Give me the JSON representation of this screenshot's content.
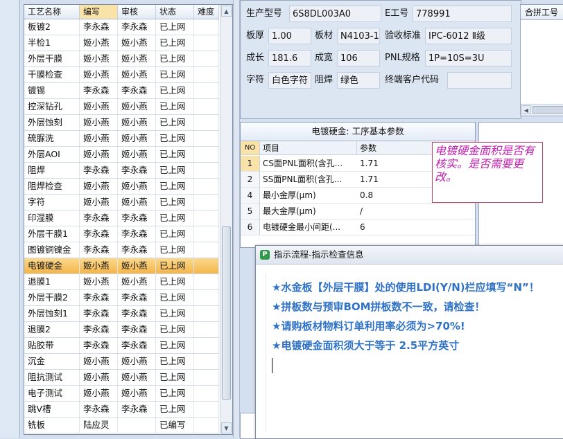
{
  "grid": {
    "headers": [
      "工艺名称",
      "编写",
      "审核",
      "状态",
      "难度"
    ],
    "rows": [
      [
        "板镀2",
        "李永森",
        "李永森",
        "已上网",
        ""
      ],
      [
        "半检1",
        "姬小燕",
        "姬小燕",
        "已上网",
        ""
      ],
      [
        "外层干膜",
        "姬小燕",
        "姬小燕",
        "已上网",
        ""
      ],
      [
        "干膜检查",
        "姬小燕",
        "姬小燕",
        "已上网",
        ""
      ],
      [
        "镀锡",
        "李永森",
        "李永森",
        "已上网",
        ""
      ],
      [
        "控深钻孔",
        "姬小燕",
        "姬小燕",
        "已上网",
        ""
      ],
      [
        "外层蚀刻",
        "姬小燕",
        "姬小燕",
        "已上网",
        ""
      ],
      [
        "硫脲洗",
        "姬小燕",
        "姬小燕",
        "已上网",
        ""
      ],
      [
        "外层AOI",
        "姬小燕",
        "姬小燕",
        "已上网",
        ""
      ],
      [
        "阻焊",
        "李永森",
        "李永森",
        "已上网",
        ""
      ],
      [
        "阻焊检查",
        "姬小燕",
        "姬小燕",
        "已上网",
        ""
      ],
      [
        "字符",
        "姬小燕",
        "姬小燕",
        "已上网",
        ""
      ],
      [
        "印湿膜",
        "李永森",
        "李永森",
        "已上网",
        ""
      ],
      [
        "外层干膜1",
        "李永森",
        "李永森",
        "已上网",
        ""
      ],
      [
        "图镀铜镍金",
        "李永森",
        "李永森",
        "已上网",
        ""
      ],
      [
        "电镀硬金",
        "姬小燕",
        "姬小燕",
        "已上网",
        ""
      ],
      [
        "退膜1",
        "姬小燕",
        "姬小燕",
        "已上网",
        ""
      ],
      [
        "外层干膜2",
        "李永森",
        "李永森",
        "已上网",
        ""
      ],
      [
        "外层蚀刻1",
        "李永森",
        "李永森",
        "已上网",
        ""
      ],
      [
        "退膜2",
        "李永森",
        "李永森",
        "已上网",
        ""
      ],
      [
        "贴胶带",
        "李永森",
        "李永森",
        "已上网",
        ""
      ],
      [
        "沉金",
        "姬小燕",
        "姬小燕",
        "已上网",
        ""
      ],
      [
        "阻抗测试",
        "姬小燕",
        "姬小燕",
        "已上网",
        ""
      ],
      [
        "电子测试",
        "姬小燕",
        "姬小燕",
        "已上网",
        ""
      ],
      [
        "跳V槽",
        "李永森",
        "李永森",
        "已上网",
        ""
      ],
      [
        "铣板",
        "陆应灵",
        "",
        "已编写",
        ""
      ]
    ],
    "selected_row": 15
  },
  "info": {
    "model_label": "生产型号",
    "model": "6S8DL003A0",
    "eno_label": "E工号",
    "eno": "778991",
    "thickness_label": "板厚",
    "thickness": "1.00",
    "material_label": "板材",
    "material": "N4103-1",
    "standard_label": "验收标准",
    "standard": "IPC-6012 Ⅱ级",
    "length_label": "成长",
    "length": "181.6",
    "width_label": "成宽",
    "width": "106",
    "pnl_label": "PNL规格",
    "pnl": "1P=10S=3U",
    "char_label": "字符",
    "char": "白色字符",
    "mask_label": "阻焊",
    "mask": "绿色",
    "customer_label": "终端客户代码",
    "customer": ""
  },
  "combine": {
    "header": "合拼工号"
  },
  "params": {
    "title": "电镀硬金: 工序基本参数",
    "headers": {
      "no": "NO",
      "item": "项目",
      "value": "参数"
    },
    "rows": [
      {
        "no": "1",
        "item": "CS面PNL面积(含孔...",
        "value": "1.71"
      },
      {
        "no": "2",
        "item": "SS面PNL面积(含孔...",
        "value": "1.71"
      },
      {
        "no": "4",
        "item": "最小金厚(μm)",
        "value": "0.8"
      },
      {
        "no": "5",
        "item": "最大金厚(μm)",
        "value": "/"
      },
      {
        "no": "6",
        "item": "电镀硬金最小间距(...",
        "value": "6"
      }
    ]
  },
  "note": "电镀硬金面积是否有核实。是否需要更改。",
  "dialog": {
    "icon": "P",
    "title": "指示流程-指示检查信息",
    "messages": [
      "★水金板【外层干膜】处的使用LDI(Y/N)栏应填写“N”！",
      "★拼板数与预审BOM拼板数不一致，请检查！",
      "★请购板材物料订单利用率必须为>70%!",
      "★电镀硬金面积须大于等于 2.5平方英寸"
    ]
  },
  "colors": {
    "selected_row": "#f4b54a",
    "message_text": "#2f72c6",
    "note_text": "#c020b0"
  }
}
